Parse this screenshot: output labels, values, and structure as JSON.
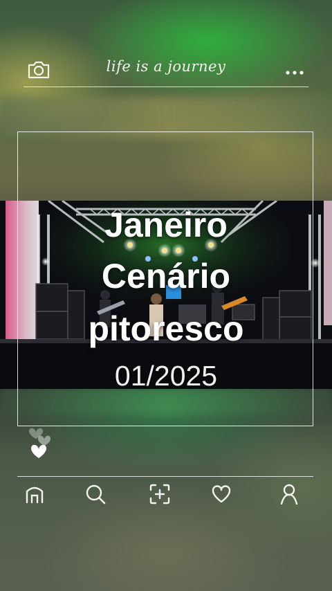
{
  "header": {
    "title": "life is a journey",
    "camera_icon": "camera-icon",
    "more_icon": "more-dots-icon"
  },
  "post": {
    "headline_lines": [
      "Janeiro",
      "Cenário",
      "pitoresco"
    ],
    "date": "01/2025"
  },
  "nav": {
    "items": [
      {
        "icon": "home-icon"
      },
      {
        "icon": "search-icon"
      },
      {
        "icon": "add-post-icon"
      },
      {
        "icon": "heart-icon"
      },
      {
        "icon": "profile-icon"
      }
    ]
  },
  "colors": {
    "text": "#ffffff",
    "stage_light_green": "#3fd23c",
    "stage_light_yellow": "#f2e28a"
  }
}
